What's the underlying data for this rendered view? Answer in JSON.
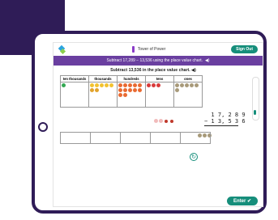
{
  "app": {
    "title": "Tower of Power",
    "signout_label": "Sign Out"
  },
  "instruction_bar": {
    "text": "Subtract 17,289 − 13,536 using the place value chart."
  },
  "activity": {
    "subtitle": "Subtract 13,536 in the place value chart.",
    "columns": [
      "ten thousands",
      "thousands",
      "hundreds",
      "tens",
      "ones"
    ],
    "equation": {
      "top": "1 7, 2 8 9",
      "bottom": "− 1 3, 5 3 6"
    }
  },
  "enter_label": "Enter",
  "colors": {
    "purple": "#6a3fa0",
    "teal": "#168e7b",
    "dark_purple": "#2f1c57"
  },
  "icons": {
    "speaker": "speaker-icon",
    "refresh": "refresh-icon",
    "check": "check-icon"
  }
}
